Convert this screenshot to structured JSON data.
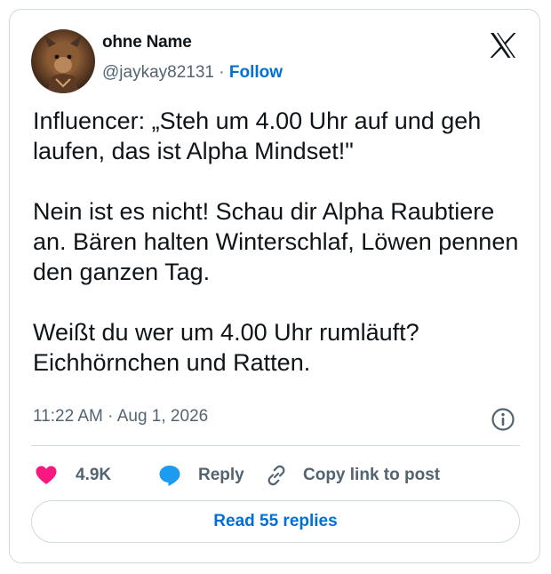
{
  "tweet": {
    "author_name": "ohne Name",
    "handle": "@jaykay82131",
    "separator": "·",
    "follow_label": "Follow",
    "paragraphs": [
      "Influencer: „Steh um 4.00 Uhr auf und geh laufen, das ist Alpha Mindset!\"",
      "Nein ist es nicht! Schau dir Alpha Raubtiere an. Bären halten Winterschlaf, Löwen pennen den ganzen Tag.",
      "Weißt du wer um 4.00 Uhr rumläuft? Eichhörnchen und Ratten."
    ],
    "time": "11:22 AM",
    "date": "Aug 1, 2026",
    "like_count": "4.9K",
    "reply_label": "Reply",
    "copy_link_label": "Copy link to post",
    "read_replies_label": "Read 55 replies"
  },
  "icons": {
    "logo": "x-logo-icon",
    "info": "info-icon",
    "like": "heart-icon",
    "reply": "speech-bubble-icon",
    "copy": "link-icon"
  },
  "colors": {
    "link_blue": "#006fd6",
    "heart_pink": "#f91880",
    "reply_blue": "#1d9bf0",
    "secondary_text": "#536471",
    "border": "#cfd9de"
  }
}
